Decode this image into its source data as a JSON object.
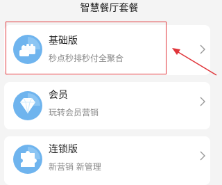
{
  "header": {
    "title": "智慧餐厅套餐"
  },
  "packages": [
    {
      "title": "基础版",
      "subtitle": "秒点秒排秒付全聚合",
      "icon": "blocks-icon"
    },
    {
      "title": "会员",
      "subtitle": "玩转会员营销",
      "icon": "diamond-icon"
    },
    {
      "title": "连锁版",
      "subtitle": "新营销 新管理",
      "icon": "puzzle-icon"
    }
  ],
  "colors": {
    "icon_blue": "#6fb4ee",
    "annotation_red": "#e0353a"
  }
}
